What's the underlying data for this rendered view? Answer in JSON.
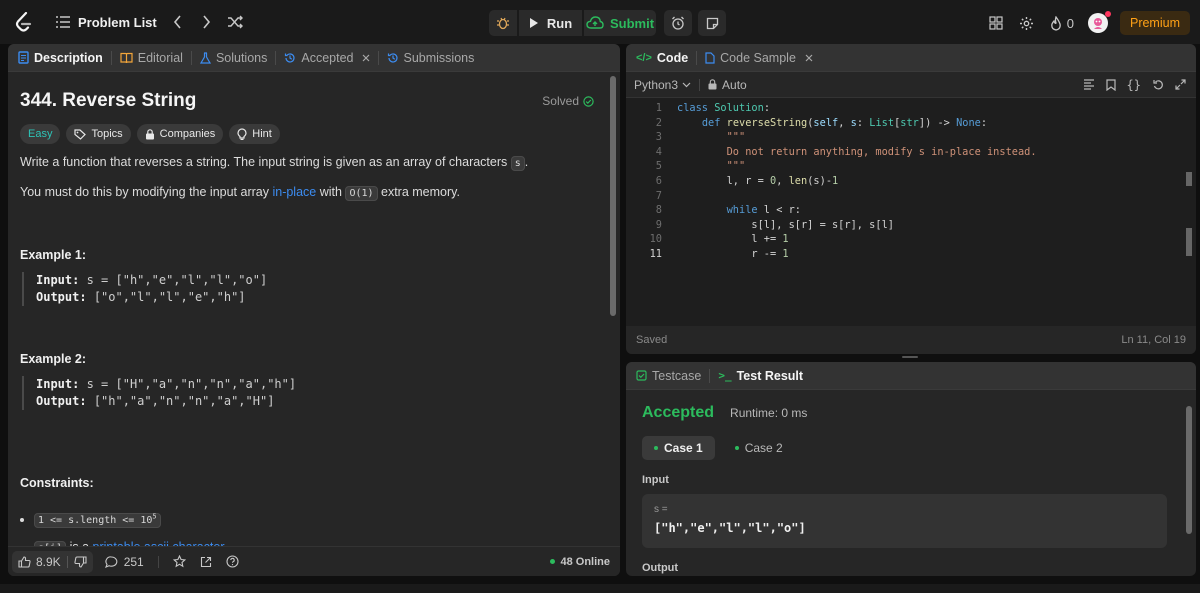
{
  "topbar": {
    "problem_list": "Problem List",
    "run": "Run",
    "submit": "Submit",
    "streak": "0",
    "premium": "Premium",
    "colors": {
      "submit": "#2cbb5d",
      "premium": "#ffa116"
    }
  },
  "left": {
    "tabs": [
      "Description",
      "Editorial",
      "Solutions",
      "Accepted",
      "Submissions"
    ],
    "title": "344. Reverse String",
    "solved": "Solved",
    "tags": [
      "Easy",
      "Topics",
      "Companies",
      "Hint"
    ],
    "para1_pre": "Write a function that reverses a string. The input string is given as an array of characters ",
    "para1_code": "s",
    "para1_post": ".",
    "para2_pre": "You must do this by modifying the input array ",
    "para2_link": "in-place",
    "para2_mid": " with ",
    "para2_code": "O(1)",
    "para2_post": " extra memory.",
    "examples": [
      {
        "title": "Example 1:",
        "input_label": "Input:",
        "input": "s = [\"h\",\"e\",\"l\",\"l\",\"o\"]",
        "output_label": "Output:",
        "output": "[\"o\",\"l\",\"l\",\"e\",\"h\"]"
      },
      {
        "title": "Example 2:",
        "input_label": "Input:",
        "input": "s = [\"H\",\"a\",\"n\",\"n\",\"a\",\"h\"]",
        "output_label": "Output:",
        "output": "[\"h\",\"a\",\"n\",\"n\",\"a\",\"H\"]"
      }
    ],
    "constraints_title": "Constraints:",
    "constraint1_code": "1 <= s.length <= 10",
    "constraint1_sup": "5",
    "constraint2_code": "s[i]",
    "constraint2_mid": " is a ",
    "constraint2_link": "printable ascii character",
    "constraint2_post": ".",
    "footer": {
      "likes": "8.9K",
      "comments": "251",
      "online": "48 Online"
    }
  },
  "code": {
    "tabs": [
      "Code",
      "Code Sample"
    ],
    "language": "Python3",
    "mode": "Auto",
    "status": "Saved",
    "cursor": "Ln 11, Col 19",
    "line_numbers": [
      "1",
      "2",
      "3",
      "4",
      "5",
      "6",
      "7",
      "8",
      "9",
      "10",
      "11"
    ]
  },
  "result": {
    "tabs": [
      "Testcase",
      "Test Result"
    ],
    "verdict": "Accepted",
    "runtime": "Runtime: 0 ms",
    "cases": [
      "Case 1",
      "Case 2"
    ],
    "input_label": "Input",
    "var_name": "s =",
    "var_value": "[\"h\",\"e\",\"l\",\"l\",\"o\"]",
    "output_label": "Output",
    "colors": {
      "accepted": "#2cbb5d"
    }
  }
}
